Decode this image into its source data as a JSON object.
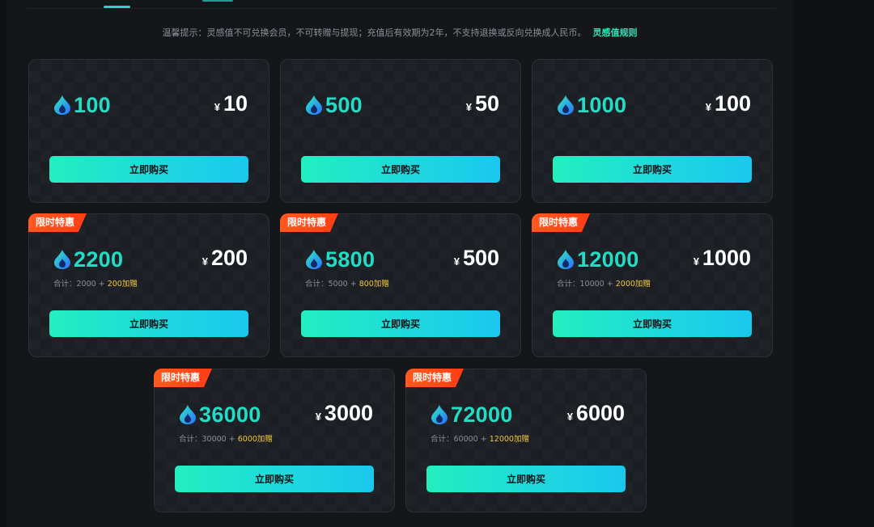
{
  "tip": {
    "text": "温馨提示：灵感值不可兑换会员，不可转赠与提现；充值后有效期为2年，不支持退换或反向兑换成人民币。",
    "rule_link": "灵感值规则"
  },
  "icons": {
    "currency": "flame-drop-icon"
  },
  "colors": {
    "accent": "#23dcc6",
    "badge": "#ff4a1a",
    "bonus": "#f3c83e",
    "button_from": "#22efbf",
    "button_to": "#1ac8ee"
  },
  "packages": [
    {
      "amount": "100",
      "yen": "¥",
      "price": "10",
      "button": "立即购买"
    },
    {
      "amount": "500",
      "yen": "¥",
      "price": "50",
      "button": "立即购买"
    },
    {
      "amount": "1000",
      "yen": "¥",
      "price": "100",
      "button": "立即购买"
    },
    {
      "badge": "限时特惠",
      "amount": "2200",
      "yen": "¥",
      "price": "200",
      "total_prefix": "合计：2000 + ",
      "bonus": "200加赠",
      "button": "立即购买"
    },
    {
      "badge": "限时特惠",
      "amount": "5800",
      "yen": "¥",
      "price": "500",
      "total_prefix": "合计：5000 + ",
      "bonus": "800加赠",
      "button": "立即购买"
    },
    {
      "badge": "限时特惠",
      "amount": "12000",
      "yen": "¥",
      "price": "1000",
      "total_prefix": "合计：10000 + ",
      "bonus": "2000加赠",
      "button": "立即购买"
    },
    {
      "badge": "限时特惠",
      "amount": "36000",
      "yen": "¥",
      "price": "3000",
      "total_prefix": "合计：30000 + ",
      "bonus": "6000加赠",
      "button": "立即购买"
    },
    {
      "badge": "限时特惠",
      "amount": "72000",
      "yen": "¥",
      "price": "6000",
      "total_prefix": "合计：60000 + ",
      "bonus": "12000加赠",
      "button": "立即购买"
    }
  ]
}
